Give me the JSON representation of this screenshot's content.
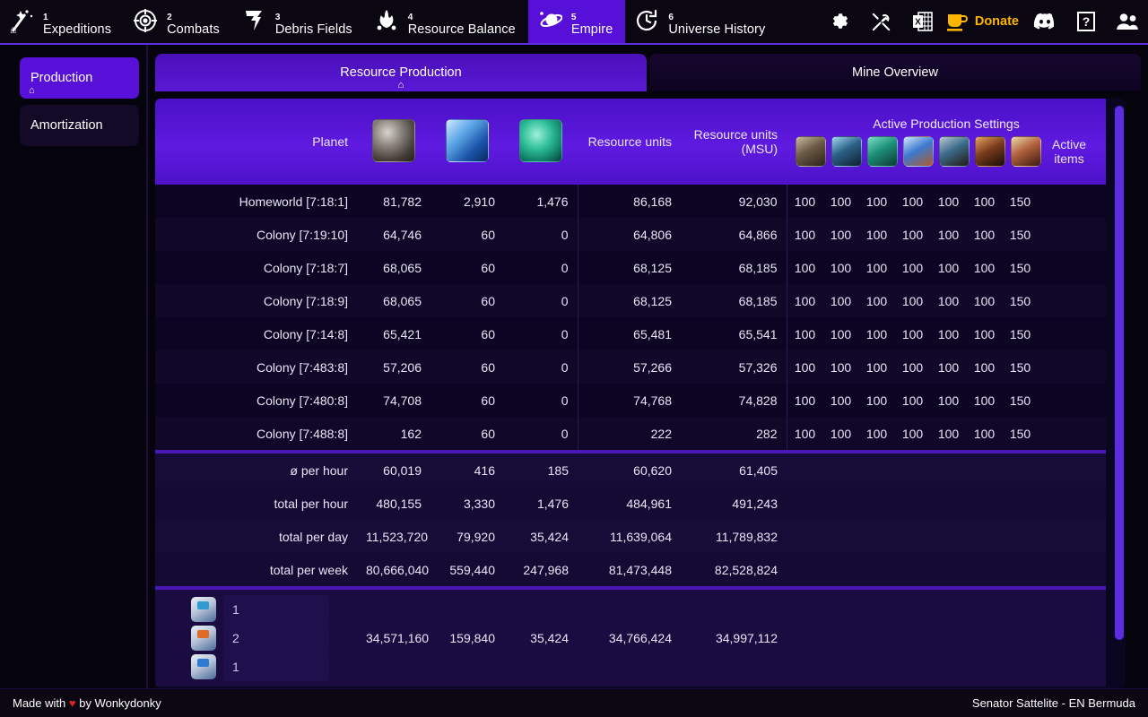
{
  "topnav": {
    "items": [
      {
        "num": "1",
        "label": "Expeditions",
        "icon": "comet-icon",
        "active": false,
        "home": true
      },
      {
        "num": "2",
        "label": "Combats",
        "icon": "target-icon",
        "active": false,
        "home": false
      },
      {
        "num": "3",
        "label": "Debris Fields",
        "icon": "debris-icon",
        "active": false,
        "home": false
      },
      {
        "num": "4",
        "label": "Resource Balance",
        "icon": "resource-balance-icon",
        "active": false,
        "home": false
      },
      {
        "num": "5",
        "label": "Empire",
        "icon": "planet-icon",
        "active": true,
        "home": false
      },
      {
        "num": "6",
        "label": "Universe History",
        "icon": "history-clock-icon",
        "active": false,
        "home": false
      }
    ],
    "actions": [
      {
        "name": "settings-icon",
        "glyph": "⚙"
      },
      {
        "name": "tools-icon",
        "glyph": "⚒"
      },
      {
        "name": "excel-export-icon",
        "glyph": "X"
      },
      {
        "name": "discord-icon",
        "glyph": "●"
      },
      {
        "name": "help-icon",
        "glyph": "?"
      },
      {
        "name": "users-icon",
        "glyph": "●"
      }
    ],
    "donate_label": "Donate"
  },
  "sidebar": {
    "items": [
      {
        "label": "Production",
        "active": true
      },
      {
        "label": "Amortization",
        "active": false
      }
    ]
  },
  "tabs": [
    {
      "label": "Resource Production",
      "active": true
    },
    {
      "label": "Mine Overview",
      "active": false
    }
  ],
  "table": {
    "headers": {
      "planet": "Planet",
      "metal": "metal-icon",
      "crystal": "crystal-icon",
      "deuterium": "deuterium-icon",
      "resource_units": "Resource units",
      "resource_units_msu": "Resource units\n(MSU)",
      "aps_title": "Active Production Settings",
      "active_items": "Active items"
    },
    "aps_icons": [
      "solar-plant-icon",
      "fusion-reactor-icon",
      "metal-mine-icon",
      "crystal-mine-icon",
      "deuterium-synthesizer-icon",
      "solar-satellite-icon",
      "crawler-icon"
    ],
    "rows": [
      {
        "planet": "Homeworld  [7:18:1]",
        "metal": "81,782",
        "crystal": "2,910",
        "deuterium": "1,476",
        "units": "86,168",
        "msu": "92,030",
        "aps": [
          "100",
          "100",
          "100",
          "100",
          "100",
          "100",
          "150"
        ]
      },
      {
        "planet": "Colony  [7:19:10]",
        "metal": "64,746",
        "crystal": "60",
        "deuterium": "0",
        "units": "64,806",
        "msu": "64,866",
        "aps": [
          "100",
          "100",
          "100",
          "100",
          "100",
          "100",
          "150"
        ]
      },
      {
        "planet": "Colony  [7:18:7]",
        "metal": "68,065",
        "crystal": "60",
        "deuterium": "0",
        "units": "68,125",
        "msu": "68,185",
        "aps": [
          "100",
          "100",
          "100",
          "100",
          "100",
          "100",
          "150"
        ]
      },
      {
        "planet": "Colony  [7:18:9]",
        "metal": "68,065",
        "crystal": "60",
        "deuterium": "0",
        "units": "68,125",
        "msu": "68,185",
        "aps": [
          "100",
          "100",
          "100",
          "100",
          "100",
          "100",
          "150"
        ]
      },
      {
        "planet": "Colony  [7:14:8]",
        "metal": "65,421",
        "crystal": "60",
        "deuterium": "0",
        "units": "65,481",
        "msu": "65,541",
        "aps": [
          "100",
          "100",
          "100",
          "100",
          "100",
          "100",
          "150"
        ]
      },
      {
        "planet": "Colony  [7:483:8]",
        "metal": "57,206",
        "crystal": "60",
        "deuterium": "0",
        "units": "57,266",
        "msu": "57,326",
        "aps": [
          "100",
          "100",
          "100",
          "100",
          "100",
          "100",
          "150"
        ]
      },
      {
        "planet": "Colony  [7:480:8]",
        "metal": "74,708",
        "crystal": "60",
        "deuterium": "0",
        "units": "74,768",
        "msu": "74,828",
        "aps": [
          "100",
          "100",
          "100",
          "100",
          "100",
          "100",
          "150"
        ]
      },
      {
        "planet": "Colony  [7:488:8]",
        "metal": "162",
        "crystal": "60",
        "deuterium": "0",
        "units": "222",
        "msu": "282",
        "aps": [
          "100",
          "100",
          "100",
          "100",
          "100",
          "100",
          "150"
        ]
      }
    ],
    "summary": [
      {
        "label": "ø per hour",
        "metal": "60,019",
        "crystal": "416",
        "deuterium": "185",
        "units": "60,620",
        "msu": "61,405"
      },
      {
        "label": "total per hour",
        "metal": "480,155",
        "crystal": "3,330",
        "deuterium": "1,476",
        "units": "484,961",
        "msu": "491,243"
      },
      {
        "label": "total per day",
        "metal": "11,523,720",
        "crystal": "79,920",
        "deuterium": "35,424",
        "units": "11,639,064",
        "msu": "11,789,832"
      },
      {
        "label": "total per week",
        "metal": "80,666,040",
        "crystal": "559,440",
        "deuterium": "247,968",
        "units": "81,473,448",
        "msu": "82,528,824"
      }
    ],
    "items_row": {
      "items": [
        {
          "icon": "item-crate-icon",
          "count": "1",
          "color": "#2f9bd0"
        },
        {
          "icon": "item-crate-icon",
          "count": "2",
          "color": "#e06a28"
        },
        {
          "icon": "item-crate-icon",
          "count": "1",
          "color": "#2f7bd0"
        }
      ],
      "metal": "34,571,160",
      "crystal": "159,840",
      "deuterium": "35,424",
      "units": "34,766,424",
      "msu": "34,997,112"
    }
  },
  "footer": {
    "made_with_prefix": "Made with",
    "made_with_suffix": "by Wonkydonky",
    "heart": "♥",
    "account": "Senator Sattelite - EN Bermuda"
  },
  "colors": {
    "accent": "#5610d8",
    "nav_bg": "#0a0612",
    "panel_bg": "#0a0520",
    "donate": "#ffb400",
    "heart": "#e02030"
  }
}
